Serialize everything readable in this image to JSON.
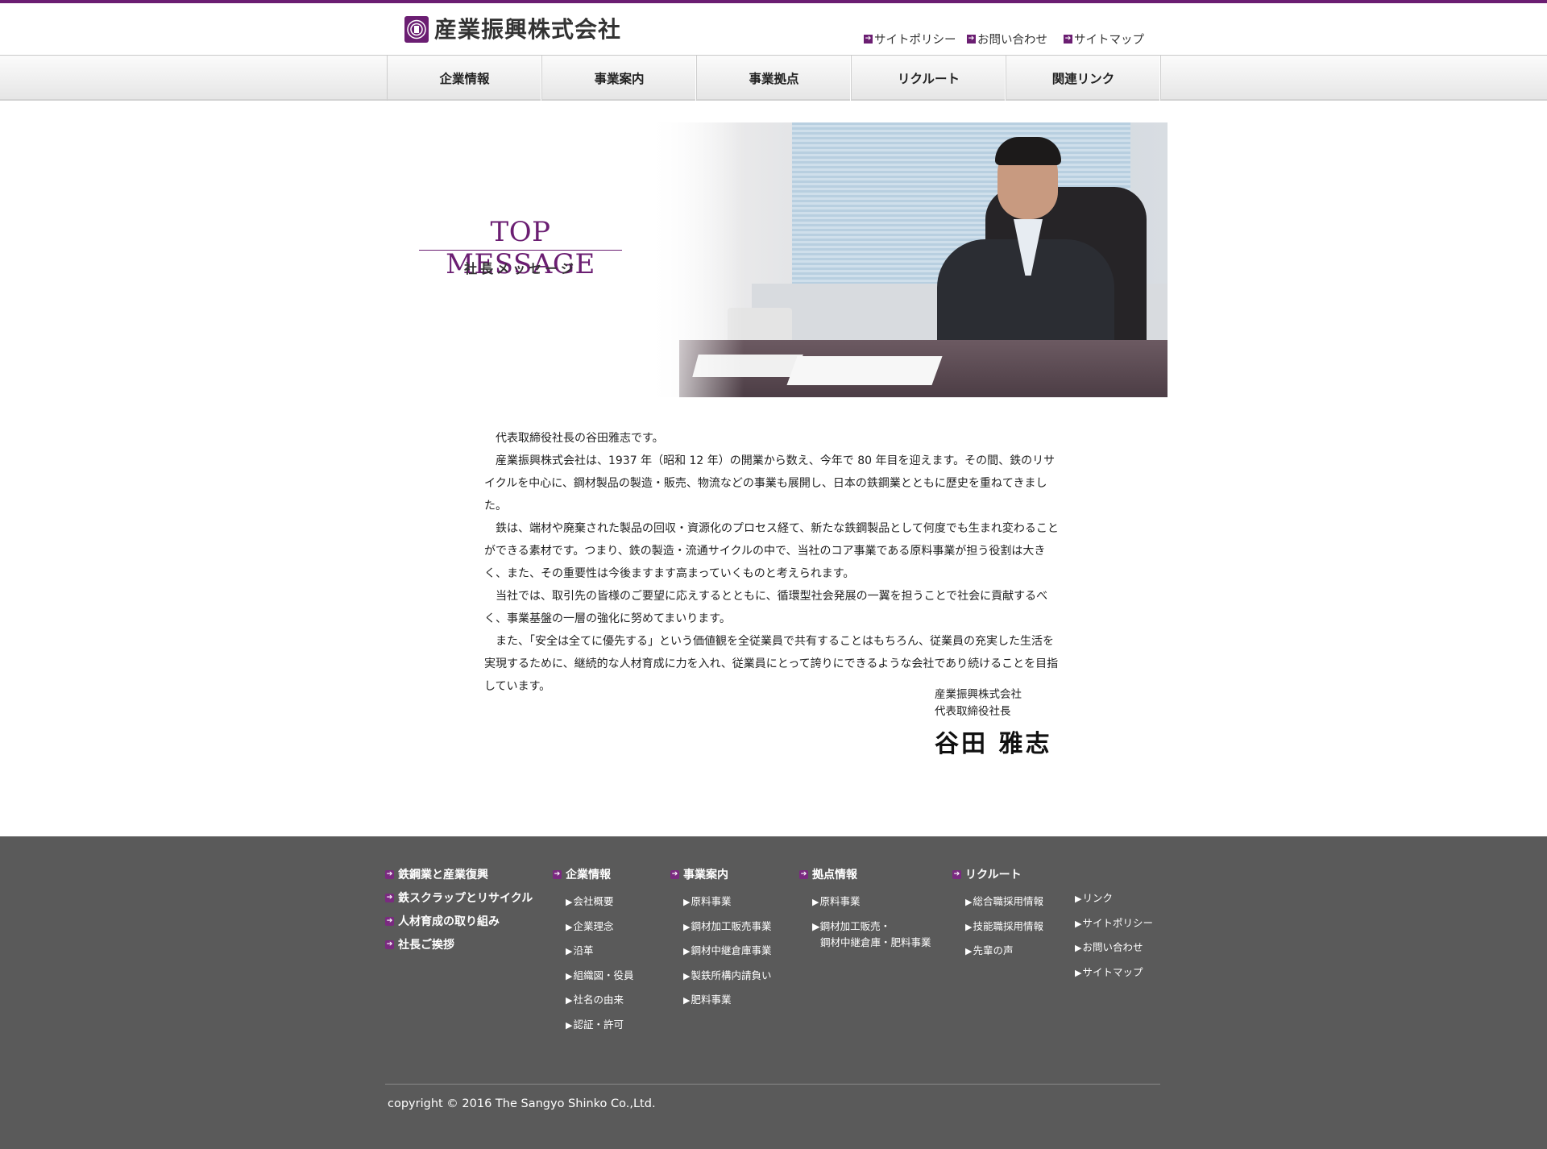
{
  "header": {
    "company_name": "産業振興株式会社",
    "links": [
      {
        "label": "サイトポリシー"
      },
      {
        "label": "お問い合わせ"
      },
      {
        "label": "サイトマップ"
      }
    ]
  },
  "nav": {
    "items": [
      "企業情報",
      "事業案内",
      "事業拠点",
      "リクルート",
      "関連リンク"
    ]
  },
  "page": {
    "title_en": "TOP MESSAGE",
    "title_ja": "社長メッセージ"
  },
  "message": {
    "paragraphs": [
      "代表取締役社長の谷田雅志です。",
      "産業振興株式会社は、1937 年（昭和 12 年）の開業から数え、今年で 80 年目を迎えます。その間、鉄のリサイクルを中心に、鋼材製品の製造・販売、物流などの事業も展開し、日本の鉄鋼業とともに歴史を重ねてきました。",
      "鉄は、端材や廃棄された製品の回収・資源化のプロセス経て、新たな鉄鋼製品として何度でも生まれ変わることができる素材です。つまり、鉄の製造・流通サイクルの中で、当社のコア事業である原料事業が担う役割は大きく、また、その重要性は今後ますます高まっていくものと考えられます。",
      "当社では、取引先の皆様のご要望に応えするとともに、循環型社会発展の一翼を担うことで社会に貢献するべく、事業基盤の一層の強化に努めてまいります。",
      "また、「安全は全てに優先する」という価値観を全従業員で共有することはもちろん、従業員の充実した生活を実現するために、継続的な人材育成に力を入れ、従業員にとって誇りにできるような会社であり続けることを目指しています。"
    ],
    "sign_company": "産業振興株式会社",
    "sign_title": "代表取締役社長",
    "signature": "谷田 雅志"
  },
  "footer": {
    "col1": [
      "鉄鋼業と産業復興",
      "鉄スクラップとリサイクル",
      "人材育成の取り組み",
      "社長ご挨拶"
    ],
    "col2": {
      "head": "企業情報",
      "items": [
        "会社概要",
        "企業理念",
        "沿革",
        "組織図・役員",
        "社名の由来",
        "認証・許可"
      ]
    },
    "col3": {
      "head": "事業案内",
      "items": [
        "原料事業",
        "鋼材加工販売事業",
        "鋼材中継倉庫事業",
        "製鉄所構内請負い",
        "肥料事業"
      ]
    },
    "col4": {
      "head": "拠点情報",
      "items": [
        "原料事業"
      ],
      "multi_line1": "鋼材加工販売・",
      "multi_line2": "鋼材中継倉庫・肥料事業"
    },
    "col5": {
      "head": "リクルート",
      "items": [
        "総合職採用情報",
        "技能職採用情報",
        "先輩の声"
      ]
    },
    "col6": {
      "items": [
        "リンク",
        "サイトポリシー",
        "お問い合わせ",
        "サイトマップ"
      ]
    },
    "copyright": "copyright © 2016 The Sangyo Shinko Co.,Ltd."
  },
  "colors": {
    "brand_purple": "#6b1e72",
    "footer_bg": "#5a5a5a"
  },
  "icons": {
    "util_link": "arrow-square-icon",
    "footer_head": "arrow-square-icon",
    "footer_item": "triangle-right-icon"
  }
}
